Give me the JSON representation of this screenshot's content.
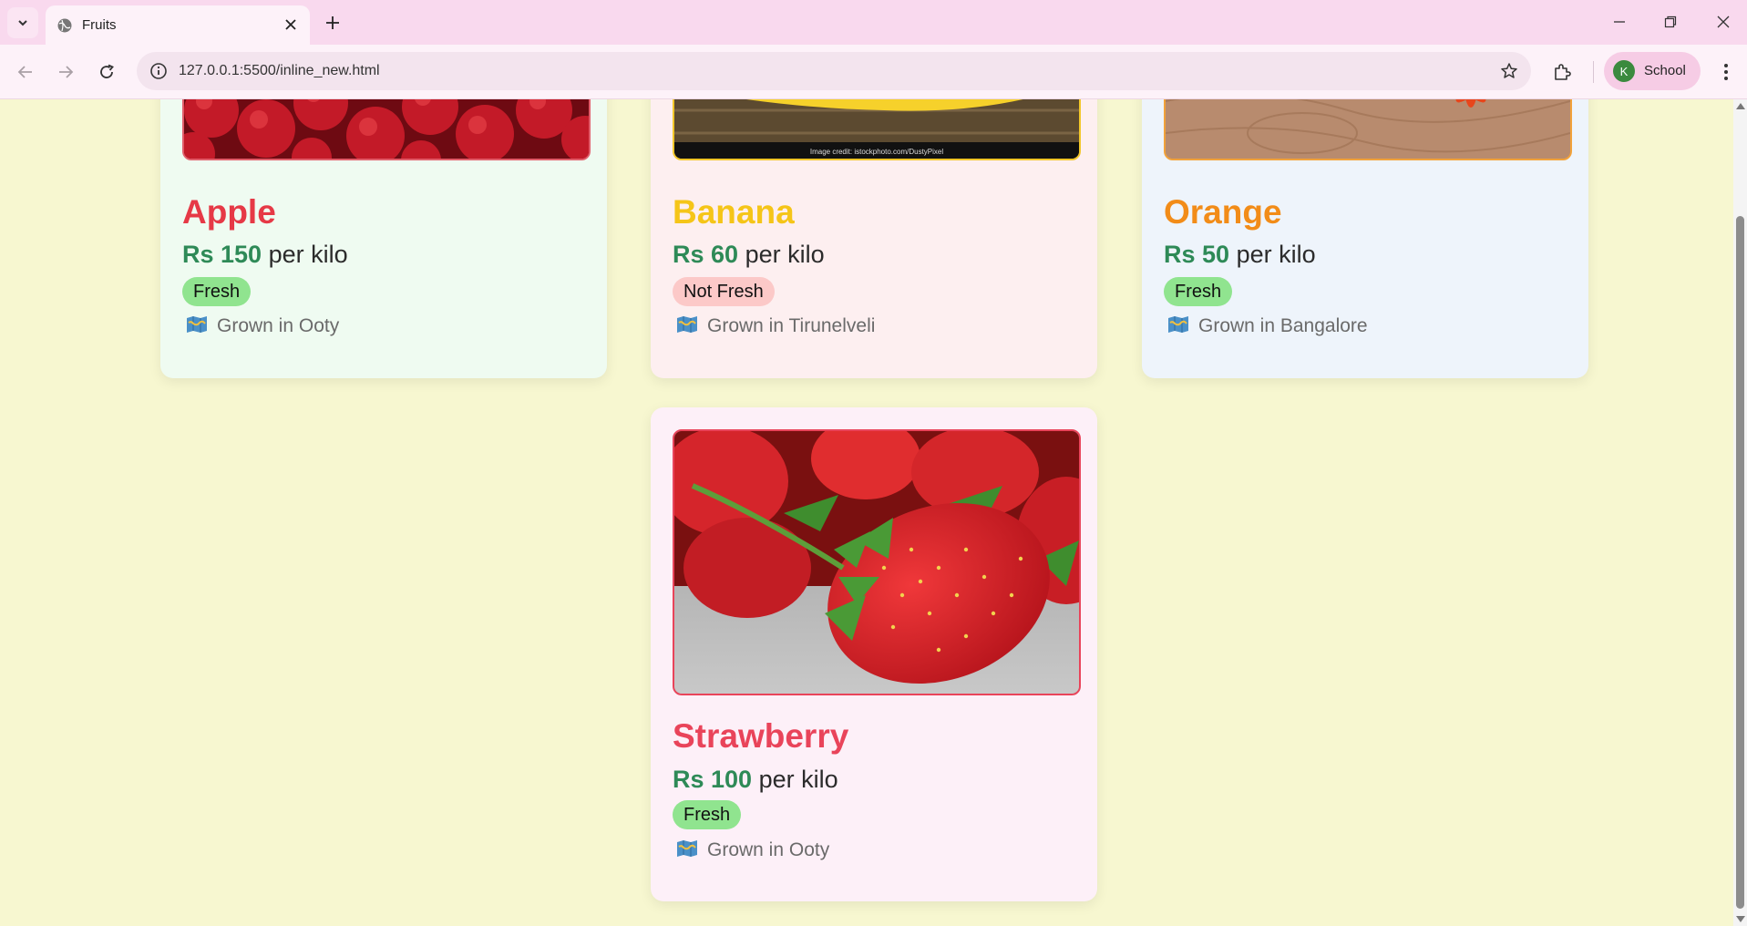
{
  "browser": {
    "tab_title": "Fruits",
    "url": "127.0.0.1:5500/inline_new.html",
    "profile_initial": "K",
    "profile_name": "School"
  },
  "colors": {
    "page_background": "#f7f7d0",
    "price_green": "#2e8a57",
    "fresh_badge": "#90e48f",
    "not_fresh_badge": "#fcc9c8"
  },
  "fruits": [
    {
      "name": "Apple",
      "price_amount": "Rs 150",
      "price_unit": "per kilo",
      "status": "Fresh",
      "origin": "Grown in Ooty",
      "name_color": "#e63946"
    },
    {
      "name": "Banana",
      "price_amount": "Rs 60",
      "price_unit": "per kilo",
      "status": "Not Fresh",
      "origin": "Grown in Tirunelveli",
      "name_color": "#f5c518",
      "image_caption": "Image credit: istockphoto.com/DustyPixel"
    },
    {
      "name": "Orange",
      "price_amount": "Rs 50",
      "price_unit": "per kilo",
      "status": "Fresh",
      "origin": "Grown in Bangalore",
      "name_color": "#f28c18"
    },
    {
      "name": "Strawberry",
      "price_amount": "Rs 100",
      "price_unit": "per kilo",
      "status": "Fresh",
      "origin": "Grown in Ooty",
      "name_color": "#e9445a"
    }
  ]
}
